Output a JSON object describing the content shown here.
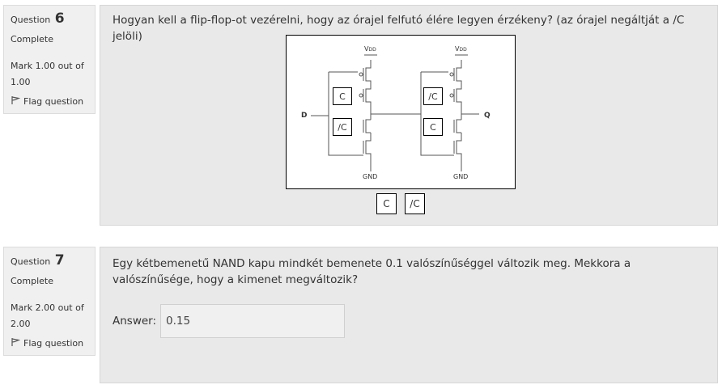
{
  "questions": [
    {
      "label": "Question",
      "number": "6",
      "state": "Complete",
      "grade": "Mark 1.00 out of 1.00",
      "flag_label": "Flag question",
      "text": "Hogyan kell a flip-flop-ot vezérelni, hogy az órajel felfutó élére legyen érzékeny? (az órajel negáltját a /C jelöli)",
      "diagram": {
        "vdd_left": "VDD",
        "vdd_right": "VDD",
        "gnd_left": "GND",
        "gnd_right": "GND",
        "input_label": "D",
        "output_label": "Q",
        "drops": [
          "C",
          "/C",
          "/C",
          "C"
        ]
      },
      "drag_items": [
        "C",
        "/C"
      ]
    },
    {
      "label": "Question",
      "number": "7",
      "state": "Complete",
      "grade": "Mark 2.00 out of 2.00",
      "flag_label": "Flag question",
      "text": "Egy kétbemenetű NAND kapu mindkét bemenete 0.1 valószínűséggel változik meg. Mekkora a valószínűsége, hogy a kimenet megváltozik?",
      "answer_label": "Answer:",
      "answer_value": "0.15"
    }
  ]
}
